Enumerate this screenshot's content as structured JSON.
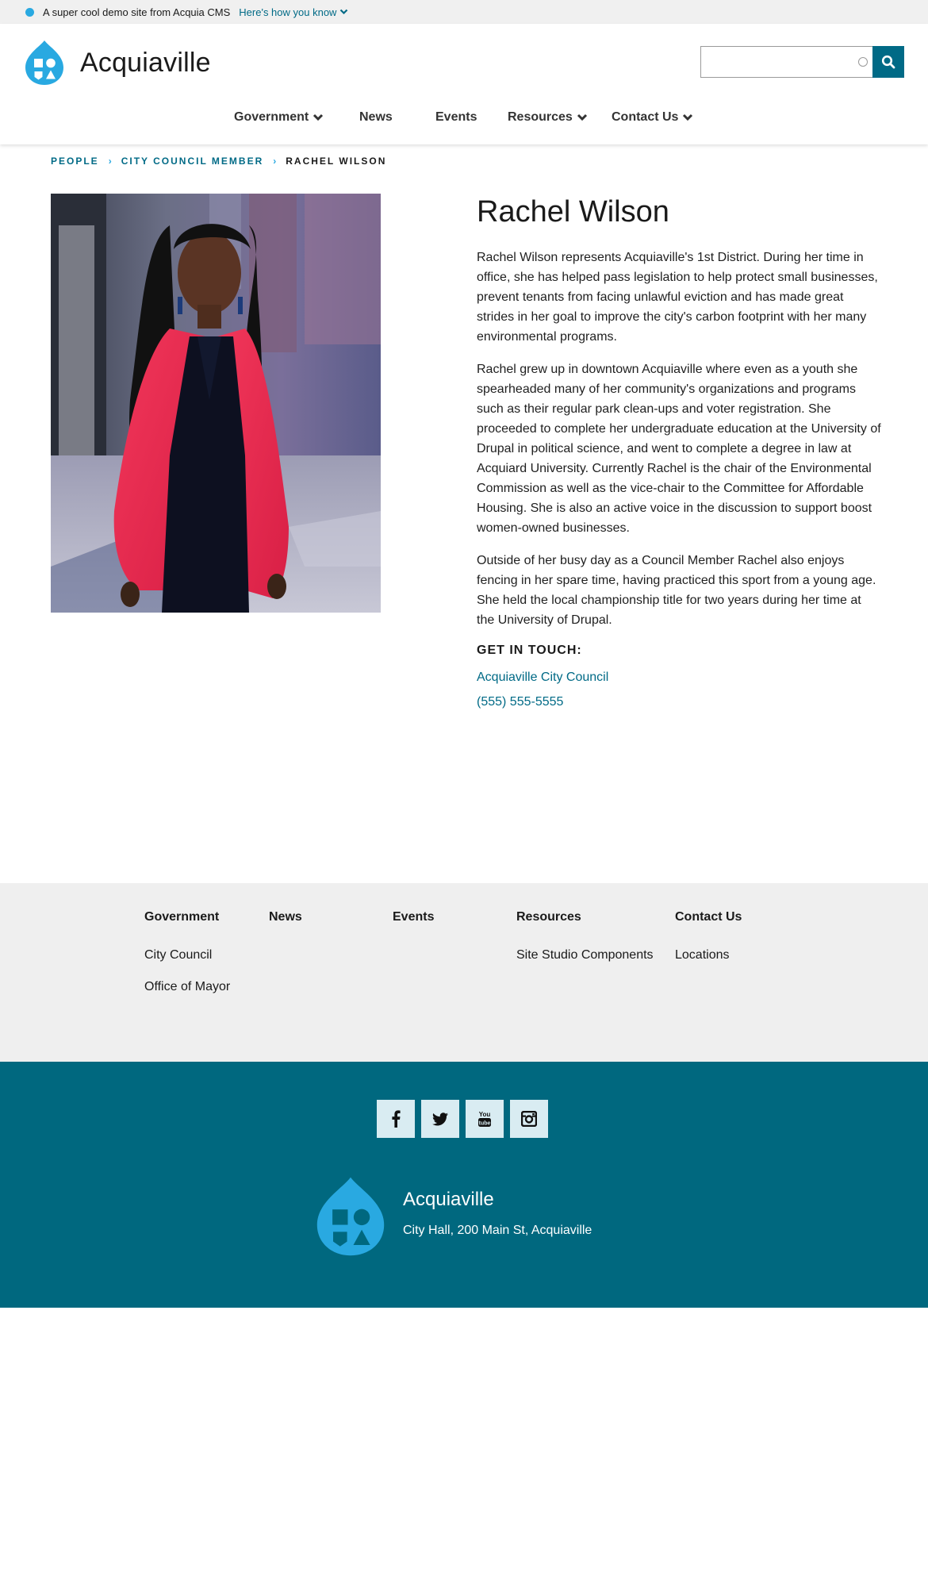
{
  "banner": {
    "text": "A super cool demo site from Acquia CMS",
    "link": "Here's how you know"
  },
  "header": {
    "site_name": "Acquiaville",
    "search_placeholder": ""
  },
  "nav": [
    {
      "label": "Government",
      "dropdown": true
    },
    {
      "label": "News",
      "dropdown": false
    },
    {
      "label": "Events",
      "dropdown": false
    },
    {
      "label": "Resources",
      "dropdown": true
    },
    {
      "label": "Contact Us",
      "dropdown": true
    }
  ],
  "breadcrumb": {
    "items": [
      "PEOPLE",
      "CITY COUNCIL MEMBER"
    ],
    "current": "RACHEL WILSON"
  },
  "person": {
    "name": "Rachel Wilson",
    "bio": [
      "Rachel Wilson represents Acquiaville's 1st District. During her time in office, she has helped pass legislation to help protect small businesses, prevent tenants from facing unlawful eviction and has made great strides in her goal to improve the city's carbon footprint with her many environmental programs.",
      "Rachel grew up in downtown Acquiaville where even as a youth she spearheaded many of her community's organizations and programs such as their regular park clean-ups and voter registration. She proceeded to complete her undergraduate education at the University of Drupal in political science, and went to complete a degree in law at Acquiard University. Currently Rachel is the chair of the Environmental Commission as well as the vice-chair to the Committee for Affordable Housing. She is also an active voice in the discussion to support boost women-owned businesses.",
      "Outside of her busy day as a Council Member Rachel also enjoys fencing in her spare time, having practiced this sport from a young age. She held the local championship title for two years during her time at the University of Drupal."
    ],
    "get_in_touch_label": "GET IN TOUCH:",
    "contact_org": "Acquiaville City Council",
    "contact_phone": "(555) 555-5555"
  },
  "footer_menu": {
    "columns": [
      {
        "heading": "Government",
        "links": [
          "City Council",
          "Office of Mayor"
        ]
      },
      {
        "heading": "News",
        "links": []
      },
      {
        "heading": "Events",
        "links": []
      },
      {
        "heading": "Resources",
        "links": [
          "Site Studio Components"
        ]
      },
      {
        "heading": "Contact Us",
        "links": [
          "Locations"
        ]
      }
    ]
  },
  "footer": {
    "social": [
      "facebook-icon",
      "twitter-icon",
      "youtube-icon",
      "instagram-icon"
    ],
    "site_name": "Acquiaville",
    "address": "City Hall, 200 Main St, Acquiaville"
  },
  "colors": {
    "brand_blue": "#29a9e1",
    "link_teal": "#006a86",
    "footer_teal": "#00687f",
    "footer_menu_bg": "#efefef"
  }
}
